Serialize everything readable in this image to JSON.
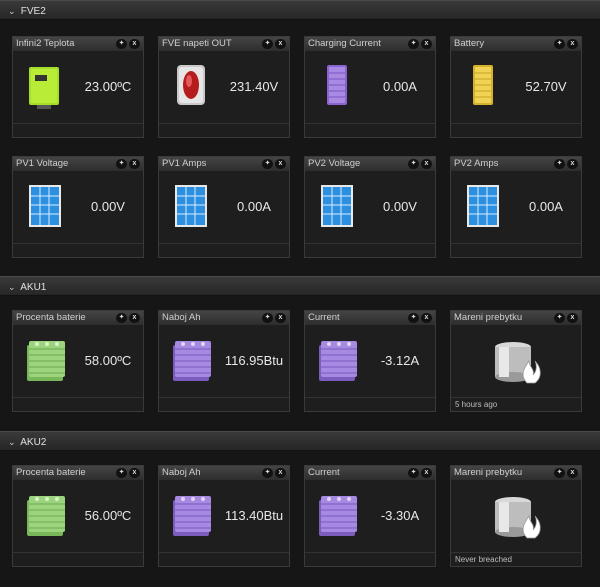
{
  "sections": [
    {
      "title": "FVE2",
      "widgets": [
        {
          "title": "Infini2 Teplota",
          "value": "23.00ºC",
          "icon": "inverter-icon"
        },
        {
          "title": "FVE napeti OUT",
          "value": "231.40V",
          "icon": "power-switch-icon"
        },
        {
          "title": "Charging Current",
          "value": "0.00A",
          "icon": "battery-purple-icon"
        },
        {
          "title": "Battery",
          "value": "52.70V",
          "icon": "battery-yellow-icon"
        },
        {
          "title": "PV1 Voltage",
          "value": "0.00V",
          "icon": "solar-panel-icon"
        },
        {
          "title": "PV1 Amps",
          "value": "0.00A",
          "icon": "solar-panel-icon"
        },
        {
          "title": "PV2 Voltage",
          "value": "0.00V",
          "icon": "solar-panel-icon"
        },
        {
          "title": "PV2 Amps",
          "value": "0.00A",
          "icon": "solar-panel-icon"
        }
      ]
    },
    {
      "title": "AKU1",
      "widgets": [
        {
          "title": "Procenta baterie",
          "value": "58.00ºC",
          "icon": "battery-pack-green-icon"
        },
        {
          "title": "Naboj Ah",
          "value": "116.95Btu",
          "icon": "battery-pack-purple-icon"
        },
        {
          "title": "Current",
          "value": "-3.12A",
          "icon": "battery-pack-purple-icon"
        },
        {
          "title": "Mareni prebytku",
          "footer": "5 hours ago",
          "icon": "flame-heater-icon"
        }
      ]
    },
    {
      "title": "AKU2",
      "widgets": [
        {
          "title": "Procenta baterie",
          "value": "56.00ºC",
          "icon": "battery-pack-green-icon"
        },
        {
          "title": "Naboj Ah",
          "value": "113.40Btu",
          "icon": "battery-pack-purple-icon"
        },
        {
          "title": "Current",
          "value": "-3.30A",
          "icon": "battery-pack-purple-icon"
        },
        {
          "title": "Mareni prebytku",
          "footer": "Never breached",
          "icon": "flame-heater-icon"
        }
      ]
    }
  ],
  "controls": {
    "configure_glyph": "🔧",
    "close_glyph": "x",
    "collapse_glyph": "⌄"
  },
  "colors": {
    "accent_green": "#9ad02a",
    "solar_blue": "#2c8fe0",
    "battery_purple": "#9b78d8",
    "battery_yellow": "#e3c238"
  }
}
